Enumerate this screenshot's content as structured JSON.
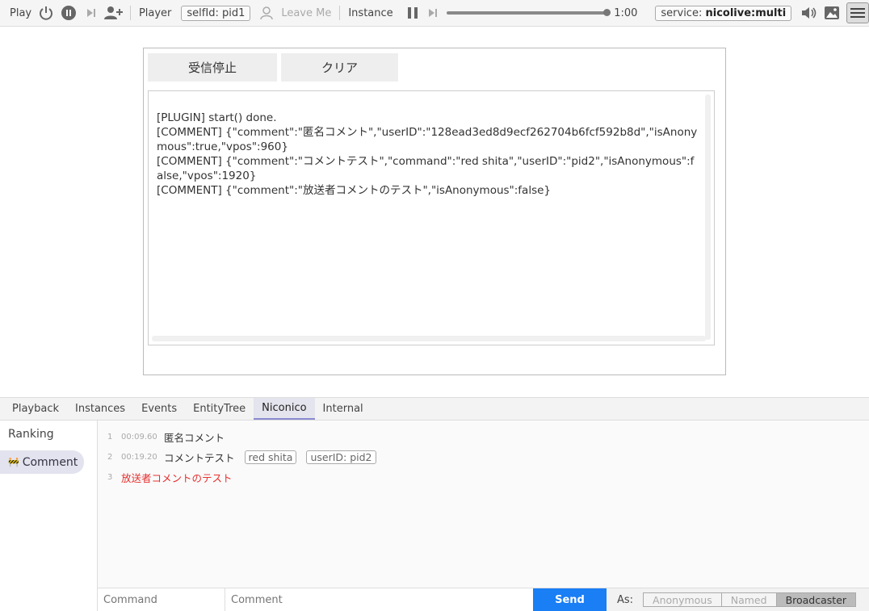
{
  "toolbar": {
    "play_label": "Play",
    "player_label": "Player",
    "self_id": "selfId: pid1",
    "leave_label": "Leave Me",
    "instance_label": "Instance",
    "time": "1:00",
    "service_prefix": "service: ",
    "service_value": "nicolive:multi"
  },
  "plugin": {
    "stop_button": "受信停止",
    "clear_button": "クリア",
    "log_lines": [
      "[PLUGIN] start() done.",
      "[COMMENT] {\"comment\":\"匿名コメント\",\"userID\":\"128ead3ed8d9ecf262704b6fcf592b8d\",\"isAnonymous\":true,\"vpos\":960}",
      "[COMMENT] {\"comment\":\"コメントテスト\",\"command\":\"red shita\",\"userID\":\"pid2\",\"isAnonymous\":false,\"vpos\":1920}",
      "[COMMENT] {\"comment\":\"放送者コメントのテスト\",\"isAnonymous\":false}"
    ]
  },
  "tabs": [
    "Playback",
    "Instances",
    "Events",
    "EntityTree",
    "Niconico",
    "Internal"
  ],
  "active_tab": "Niconico",
  "nav": {
    "ranking": "Ranking",
    "comment": "Comment",
    "comment_icon": "🚧"
  },
  "comments": [
    {
      "num": "1",
      "time": "00:09.60",
      "text": "匿名コメント"
    },
    {
      "num": "2",
      "time": "00:19.20",
      "text": "コメントテスト",
      "command": "red shita",
      "user": "userID: pid2"
    },
    {
      "num": "3",
      "time": "",
      "text": "放送者コメントのテスト"
    }
  ],
  "input": {
    "command_placeholder": "Command",
    "comment_placeholder": "Comment",
    "send_label": "Send",
    "as_label": "As:",
    "as_options": [
      "Anonymous",
      "Named",
      "Broadcaster"
    ],
    "as_selected": "Broadcaster"
  },
  "colors": {
    "accent": "#1a7ef5",
    "broadcaster_comment": "#e53030"
  }
}
